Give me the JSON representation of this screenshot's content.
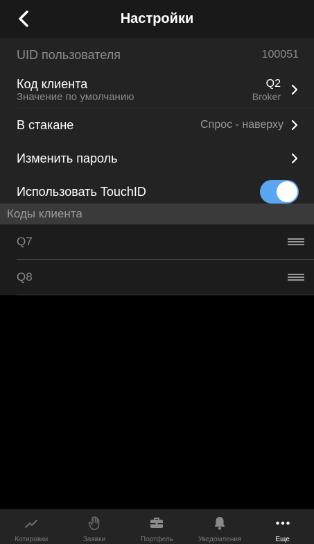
{
  "header": {
    "title": "Настройки"
  },
  "settings": {
    "uid": {
      "label": "UID пользователя",
      "value": "100051"
    },
    "client_code": {
      "label": "Код клиента",
      "sublabel": "Значение по умолчанию",
      "code": "Q2",
      "account": "Broker"
    },
    "orderbook": {
      "label": "В стакане",
      "value": "Спрос - наверху"
    },
    "change_password": {
      "label": "Изменить пароль"
    },
    "touch_id": {
      "label": "Использовать TouchID",
      "enabled": true
    }
  },
  "client_codes": {
    "section_title": "Коды клиента",
    "items": [
      {
        "label": "Q7"
      },
      {
        "label": "Q8"
      }
    ]
  },
  "tabbar": {
    "tabs": [
      {
        "label": "Котировки",
        "icon": "chart-line-icon"
      },
      {
        "label": "Заявки",
        "icon": "hand-icon"
      },
      {
        "label": "Портфель",
        "icon": "briefcase-icon"
      },
      {
        "label": "Уведомления",
        "icon": "bell-icon"
      },
      {
        "label": "Еще",
        "icon": "more-dots-icon",
        "active": true
      }
    ]
  },
  "colors": {
    "toggle_on": "#5aa6f0",
    "background": "#000000",
    "section_header": "#3a3a3a"
  }
}
